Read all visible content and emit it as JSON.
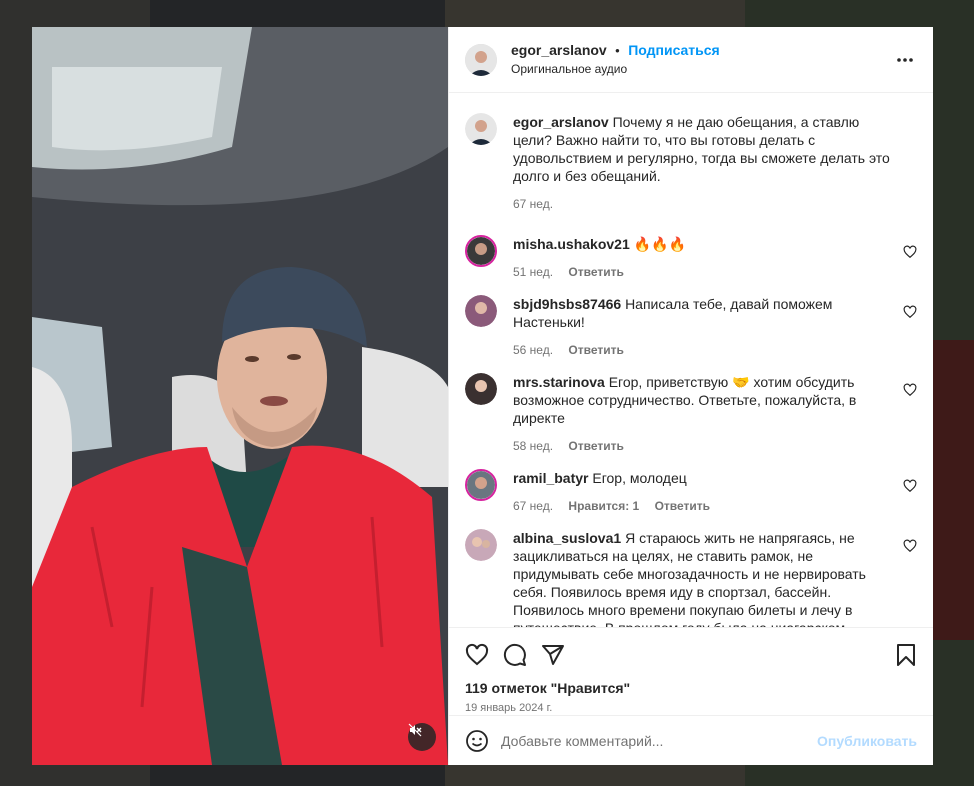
{
  "post": {
    "author": "egor_arslanov",
    "follow_label": "Подписаться",
    "separator": "•",
    "audio_label": "Оригинальное аудио",
    "caption_text": "Почему я не даю обещания, а ставлю цели? Важно найти то, что вы готовы делать с удовольствием и регулярно, тогда вы сможете делать это долго и без обещаний.",
    "caption_time": "67 нед.",
    "likes_label": "119 отметок \"Нравится\"",
    "date_label": "19 январь 2024 г."
  },
  "comments": [
    {
      "user": "misha.ushakov21",
      "text": "🔥🔥🔥",
      "time": "51 нед.",
      "likes": "",
      "reply": "Ответить"
    },
    {
      "user": "sbjd9hsbs87466",
      "text": "Написала тебе, давай поможем Настеньки!",
      "time": "56 нед.",
      "likes": "",
      "reply": "Ответить"
    },
    {
      "user": "mrs.starinova",
      "text": "Егор, приветствую 🤝 хотим обсудить возможное сотрудничество. Ответьте, пожалуйста, в директе",
      "time": "58 нед.",
      "likes": "",
      "reply": "Ответить"
    },
    {
      "user": "ramil_batyr",
      "text": "Егор, молодец",
      "time": "67 нед.",
      "likes": "Нравится: 1",
      "reply": "Ответить"
    },
    {
      "user": "albina_suslova1",
      "text": "Я стараюсь жить не напрягаясь, не зацикливаться на целях, не ставить рамок, не придумывать себе многозадачность и не нервировать себя. Появилось время иду в спортзал, бассейн. Появилось много времени покупаю билеты и лечу в путешествие. В прошлом году была на ниагарском водопаде, в Портланд на поезде",
      "time": "",
      "likes": "",
      "reply": ""
    }
  ],
  "composer": {
    "placeholder": "Добавьте комментарий...",
    "publish_label": "Опубликовать"
  },
  "icons": {
    "more": "more-options-icon",
    "like": "heart-icon",
    "comment": "comment-icon",
    "share": "share-icon",
    "save": "bookmark-icon",
    "emoji": "emoji-icon",
    "mute": "mute-icon"
  },
  "colors": {
    "accent": "#0095f6",
    "publish_disabled": "#b3dbff",
    "jacket": "#e8283a",
    "beanie": "#3c4a5c"
  }
}
